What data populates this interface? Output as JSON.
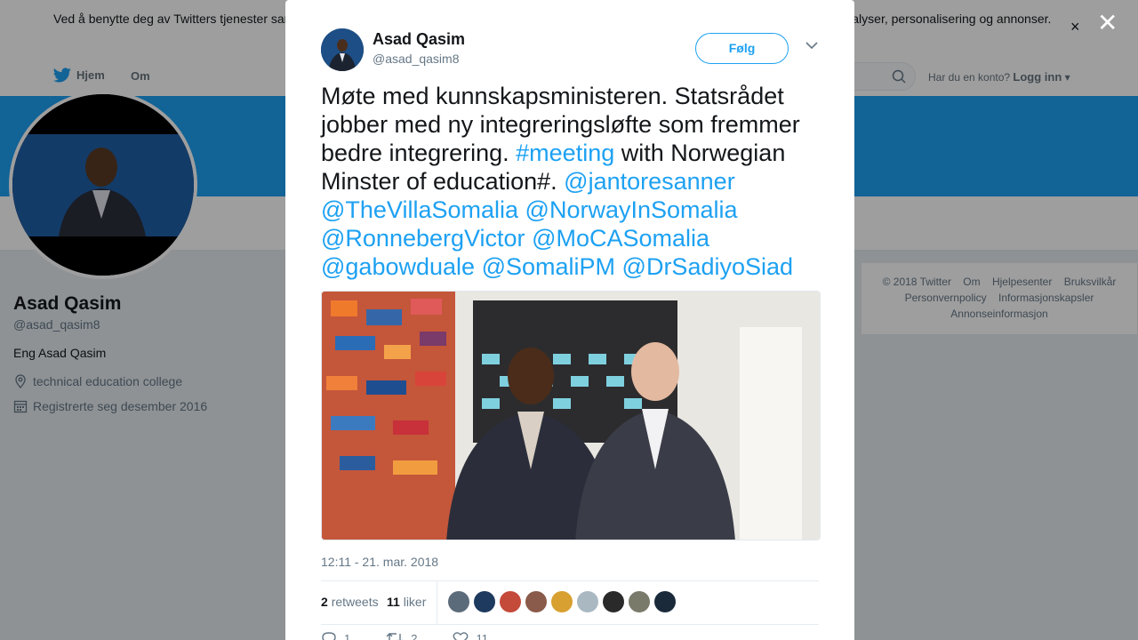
{
  "cookie": {
    "text": "Ved å benytte deg av Twitters tjenester samtykker du i vår bruk av informasjonskapsler. Vi og våre partnere bruker informasjonskapsler til bl.a. analyser, personalisering og annonser.",
    "close": "×"
  },
  "nav": {
    "home": "Hjem",
    "about": "Om",
    "login_prompt": "Har du en konto?",
    "login": "Logg inn"
  },
  "profile": {
    "name": "Asad Qasim",
    "handle": "@asad_qasim8",
    "bio": "Eng Asad Qasim",
    "location": "technical education college",
    "joined": "Registrerte seg desember 2016"
  },
  "footer": {
    "links": [
      "© 2018 Twitter",
      "Om",
      "Hjelpesenter",
      "Bruksvilkår",
      "Personvernpolicy",
      "Informasjonskapsler",
      "Annonseinformasjon"
    ]
  },
  "overlay": {
    "close": "✕"
  },
  "tweet": {
    "name": "Asad Qasim",
    "handle": "@asad_qasim8",
    "follow": "Følg",
    "text_plain": "Møte med kunnskapsministeren. Statsrådet jobber med ny integreringsløfte som fremmer bedre integrering.",
    "hashtag": "#meeting",
    "text_mid": "with Norwegian Minster of education#.",
    "mentions": [
      "@jantoresanner",
      "@TheVillaSomalia",
      "@NorwayInSomalia",
      "@RonnebergVictor",
      "@MoCASomalia",
      "@gabowduale",
      "@SomaliPM",
      "@DrSadiyoSiad"
    ],
    "timestamp": "12:11 - 21. mar. 2018",
    "retweets_count": "2",
    "retweets_label": "retweets",
    "likes_count": "11",
    "likes_label": "liker",
    "reply_count": "1",
    "retweet_action_count": "2",
    "like_action_count": "11"
  },
  "colors": {
    "accent": "#1da1f2",
    "text": "#14171a",
    "secondary": "#657786"
  }
}
